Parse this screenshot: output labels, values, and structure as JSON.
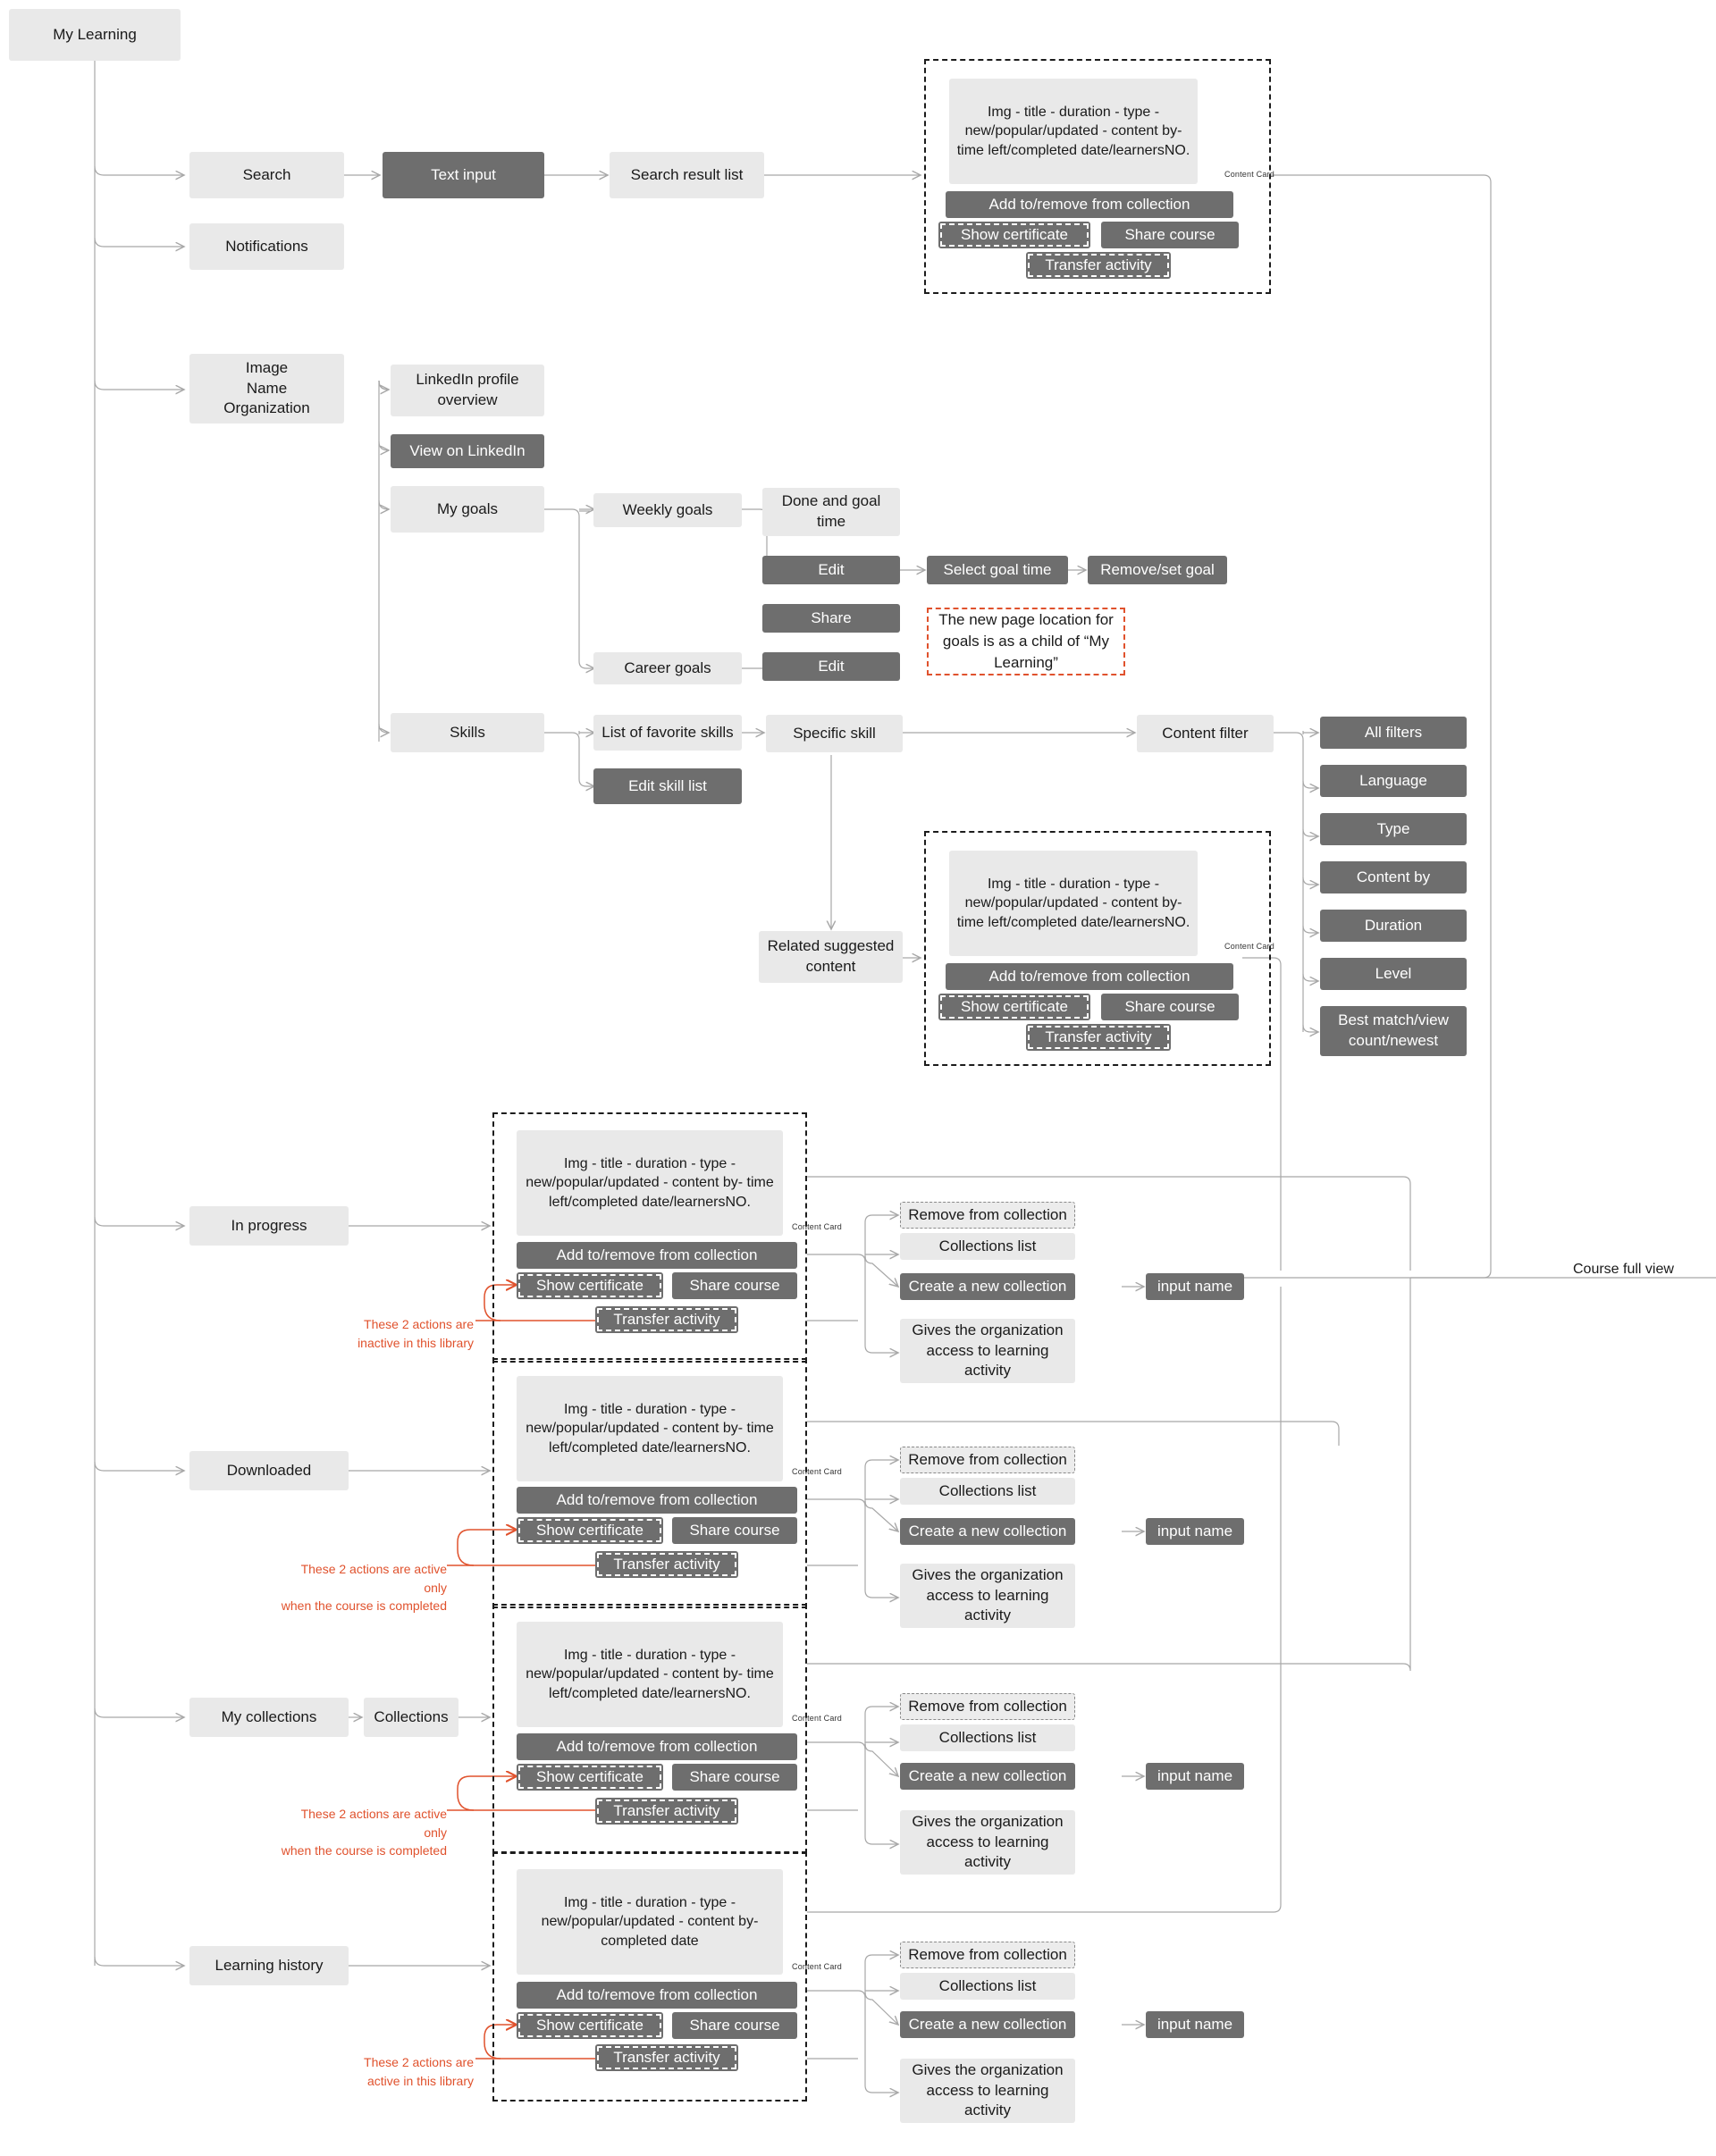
{
  "diagram": {
    "title": "My Learning",
    "root": {
      "label": "My Learning"
    },
    "colors": {
      "light_node": "#e9e9e9",
      "dark_node": "#6e6e6e",
      "annotation_red": "#e0522d",
      "wire": "#a8a8a8",
      "card_border": "#1c1c1c",
      "background": "#ffffff"
    },
    "nodes": {
      "search": "Search",
      "text_input": "Text input",
      "search_result_list": "Search result list",
      "notifications": "Notifications",
      "profile": "Image\nName\nOrganization",
      "linkedin_profile_overview": "LinkedIn profile overview",
      "view_on_linkedin": "View on LinkedIn",
      "my_goals": "My goals",
      "weekly_goals": "Weekly goals",
      "career_goals": "Career goals",
      "done_and_goal_time": "Done and goal time",
      "edit_weekly": "Edit",
      "share_weekly": "Share",
      "edit_career": "Edit",
      "select_goal_time": "Select goal time",
      "remove_set_goal": "Remove/set goal",
      "skills": "Skills",
      "list_of_favorite_skills": "List of favorite skills",
      "edit_skill_list": "Edit skill list",
      "specific_skill": "Specific skill",
      "related_suggested_content": "Related suggested content",
      "content_filter": "Content filter",
      "in_progress": "In progress",
      "downloaded": "Downloaded",
      "my_collections": "My collections",
      "collections": "Collections",
      "learning_history": "Learning history"
    },
    "notes": {
      "goals_location": "The new page location for goals is as a child of “My Learning”"
    },
    "edge_labels": {
      "course_full_view": "Course full view"
    },
    "content_card": {
      "label": "Content Card",
      "body_default": "Img - title - duration - type - new/popular/updated - content by- time left/completed date/learnersNO.",
      "body_history": "Img - title - duration - type - new/popular/updated - content by- completed date",
      "actions": {
        "add_remove": "Add to/remove from collection",
        "show_certificate": "Show certificate",
        "share_course": "Share course",
        "transfer_activity": "Transfer activity"
      }
    },
    "filter_options": [
      "All filters",
      "Language",
      "Type",
      "Content by",
      "Duration",
      "Level",
      "Best match/view count/newest"
    ],
    "collection_actions": {
      "remove_from_collection": "Remove from collection",
      "collections_list": "Collections list",
      "create_a_new_collection": "Create a new collection",
      "input_name": "input name",
      "gives_org_access": "Gives the organization access to learning activity"
    },
    "annotations": {
      "in_progress": "These 2 actions are\ninactive in this library",
      "downloaded": "These 2 actions are active only\nwhen the course is completed",
      "my_collections": "These 2 actions are active only\nwhen the course is completed",
      "learning_history": "These 2 actions are\nactive in this library"
    }
  }
}
